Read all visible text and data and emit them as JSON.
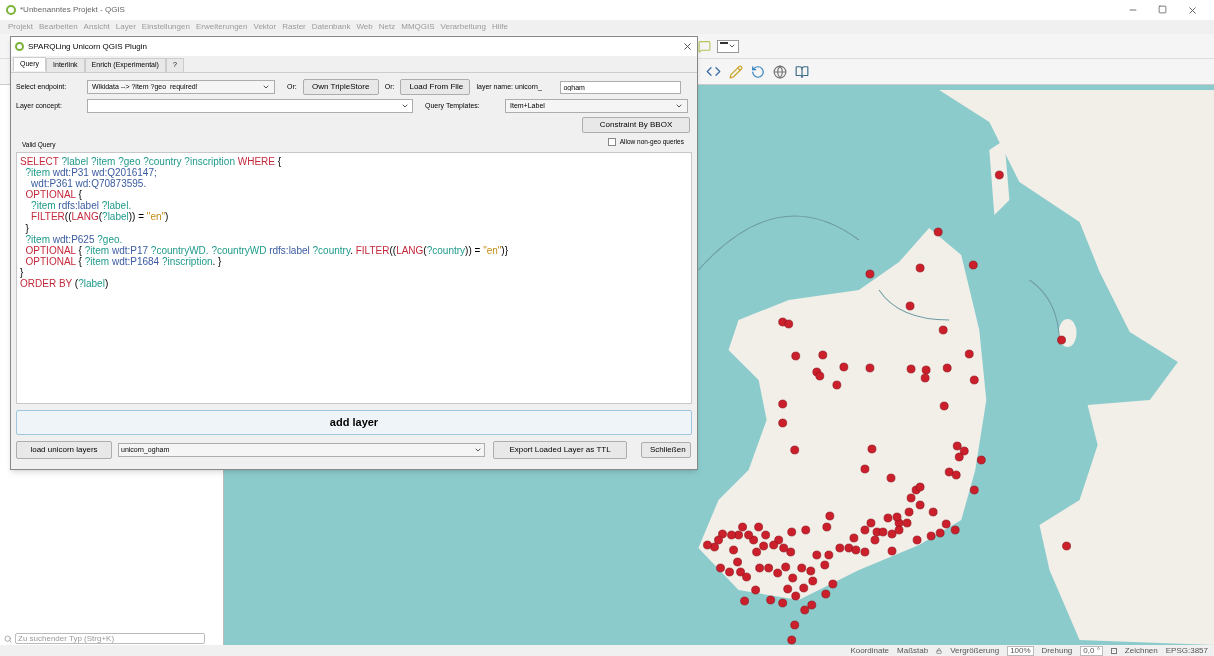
{
  "window": {
    "title": "*Unbenanntes Projekt - QGIS"
  },
  "menu": [
    "Projekt",
    "Bearbeiten",
    "Ansicht",
    "Layer",
    "Einstellungen",
    "Erweiterungen",
    "Vektor",
    "Raster",
    "Datenbank",
    "Web",
    "Netz",
    "MMQGIS",
    "Verarbeitung",
    "Hilfe"
  ],
  "dialog": {
    "title": "SPARQLing Unicorn QGIS Plugin",
    "tabs": [
      {
        "label": "Query",
        "selected": true
      },
      {
        "label": "Interlink",
        "selected": false
      },
      {
        "label": "Enrich (Experimental)",
        "selected": false
      },
      {
        "label": "?",
        "selected": false
      }
    ],
    "endpoint_label": "Select endpoint:",
    "endpoint_value": "Wikidata --> ?item ?geo  required!",
    "or_labels": [
      "Or:",
      "Or:"
    ],
    "own_triplestore_button": "Own TripleStore",
    "load_file_button": "Load From File",
    "layer_name_label": "layer name: unicorn_",
    "layer_name_value": "ogham",
    "layer_concept_label": "Layer concept:",
    "templates_label": "Query Templates:",
    "templates_value": "Item+Label",
    "constraint_button": "Constraint By BBOX",
    "valid_label": "Valid Query",
    "allow_nongeo": {
      "label": "Allow non-geo queries",
      "checked": false
    },
    "query_lines": [
      [
        {
          "kind": "kw",
          "text": "SELECT"
        },
        {
          "kind": "var",
          "text": " ?label ?item ?geo ?country ?inscription "
        },
        {
          "kind": "kw",
          "text": "WHERE"
        },
        {
          "kind": "plain",
          "text": " {"
        }
      ],
      [
        {
          "kind": "var",
          "text": "  ?item"
        },
        {
          "kind": "pname",
          "text": " wdt:P31 wd:Q2016147;"
        }
      ],
      [
        {
          "kind": "pname",
          "text": "    wdt:P361 wd:Q70873595."
        }
      ],
      [
        {
          "kind": "kw",
          "text": "  OPTIONAL"
        },
        {
          "kind": "plain",
          "text": " {"
        }
      ],
      [
        {
          "kind": "var",
          "text": "    ?item"
        },
        {
          "kind": "pname",
          "text": " rdfs:label"
        },
        {
          "kind": "var",
          "text": " ?label."
        }
      ],
      [
        {
          "kind": "kw",
          "text": "    FILTER"
        },
        {
          "kind": "plain",
          "text": "(("
        },
        {
          "kind": "kw",
          "text": "LANG"
        },
        {
          "kind": "plain",
          "text": "("
        },
        {
          "kind": "var",
          "text": "?label"
        },
        {
          "kind": "plain",
          "text": ")) = "
        },
        {
          "kind": "str",
          "text": "\"en\""
        },
        {
          "kind": "plain",
          "text": ")"
        }
      ],
      [
        {
          "kind": "plain",
          "text": "  }"
        }
      ],
      [
        {
          "kind": "var",
          "text": "  ?item"
        },
        {
          "kind": "pname",
          "text": " wdt:P625"
        },
        {
          "kind": "var",
          "text": " ?geo."
        }
      ],
      [
        {
          "kind": "kw",
          "text": "  OPTIONAL"
        },
        {
          "kind": "plain",
          "text": " { "
        },
        {
          "kind": "var",
          "text": "?item"
        },
        {
          "kind": "pname",
          "text": " wdt:P17"
        },
        {
          "kind": "var",
          "text": " ?countryWD. ?countryWD"
        },
        {
          "kind": "pname",
          "text": " rdfs:label"
        },
        {
          "kind": "var",
          "text": " ?country"
        },
        {
          "kind": "plain",
          "text": ". "
        },
        {
          "kind": "kw",
          "text": "FILTER"
        },
        {
          "kind": "plain",
          "text": "(("
        },
        {
          "kind": "kw",
          "text": "LANG"
        },
        {
          "kind": "plain",
          "text": "("
        },
        {
          "kind": "var",
          "text": "?country"
        },
        {
          "kind": "plain",
          "text": ")) = "
        },
        {
          "kind": "str",
          "text": "\"en\""
        },
        {
          "kind": "plain",
          "text": ")}"
        }
      ],
      [
        {
          "kind": "kw",
          "text": "  OPTIONAL"
        },
        {
          "kind": "plain",
          "text": " { "
        },
        {
          "kind": "var",
          "text": "?item"
        },
        {
          "kind": "pname",
          "text": " wdt:P1684"
        },
        {
          "kind": "var",
          "text": " ?inscription"
        },
        {
          "kind": "plain",
          "text": ". }"
        }
      ],
      [
        {
          "kind": "plain",
          "text": "}"
        }
      ],
      [
        {
          "kind": "kw",
          "text": "ORDER BY"
        },
        {
          "kind": "plain",
          "text": " ("
        },
        {
          "kind": "var",
          "text": "?label"
        },
        {
          "kind": "plain",
          "text": ")"
        }
      ]
    ],
    "add_layer_button": "add layer",
    "load_layers_button": "load unicorn layers",
    "layer_select_value": "unicorn_ogham",
    "export_button": "Export Loaded Layer as TTL",
    "close_button": "Schließen"
  },
  "locator": {
    "placeholder": "Zu suchender Typ (Strg+K)"
  },
  "status_bar": {
    "coordinate_label": "Koordinate",
    "scale_label": "Maßstab",
    "magnifier_label": "Vergrößerung",
    "magnifier_value": "100%",
    "rotation_label": "Drehung",
    "rotation_value": "0,0 °",
    "render": {
      "label": "Zeichnen",
      "checked": true
    },
    "crs": "EPSG:3857"
  }
}
